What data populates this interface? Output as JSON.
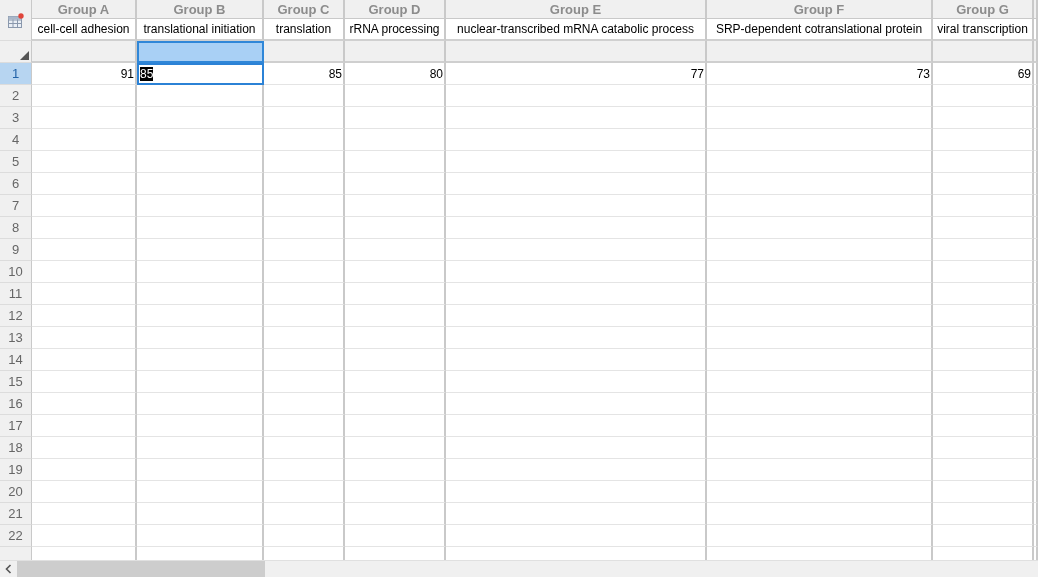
{
  "columns": [
    {
      "group": "Group A",
      "title": "cell-cell adhesion",
      "selected": false
    },
    {
      "group": "Group B",
      "title": "translational initiation",
      "selected": true
    },
    {
      "group": "Group C",
      "title": "translation",
      "selected": false
    },
    {
      "group": "Group D",
      "title": "rRNA processing",
      "selected": false
    },
    {
      "group": "Group E",
      "title": "nuclear-transcribed mRNA catabolic process",
      "selected": false
    },
    {
      "group": "Group F",
      "title": "SRP-dependent cotranslational protein",
      "selected": false
    },
    {
      "group": "Group G",
      "title": "viral transcription",
      "selected": false
    }
  ],
  "rows": [
    {
      "label": "1",
      "selected": true,
      "cells": [
        {
          "value": "91",
          "selected": false
        },
        {
          "value": "85",
          "selected": true
        },
        {
          "value": "85",
          "selected": false
        },
        {
          "value": "80",
          "selected": false
        },
        {
          "value": "77",
          "selected": false
        },
        {
          "value": "73",
          "selected": false
        },
        {
          "value": "69",
          "selected": false
        }
      ]
    },
    {
      "label": "2",
      "selected": false
    },
    {
      "label": "3",
      "selected": false
    },
    {
      "label": "4",
      "selected": false
    },
    {
      "label": "5",
      "selected": false
    },
    {
      "label": "6",
      "selected": false
    },
    {
      "label": "7",
      "selected": false
    },
    {
      "label": "8",
      "selected": false
    },
    {
      "label": "9",
      "selected": false
    },
    {
      "label": "10",
      "selected": false
    },
    {
      "label": "11",
      "selected": false
    },
    {
      "label": "12",
      "selected": false
    },
    {
      "label": "13",
      "selected": false
    },
    {
      "label": "14",
      "selected": false
    },
    {
      "label": "15",
      "selected": false
    },
    {
      "label": "16",
      "selected": false
    },
    {
      "label": "17",
      "selected": false
    },
    {
      "label": "18",
      "selected": false
    },
    {
      "label": "19",
      "selected": false
    },
    {
      "label": "20",
      "selected": false
    },
    {
      "label": "21",
      "selected": false
    },
    {
      "label": "22",
      "selected": false
    }
  ]
}
